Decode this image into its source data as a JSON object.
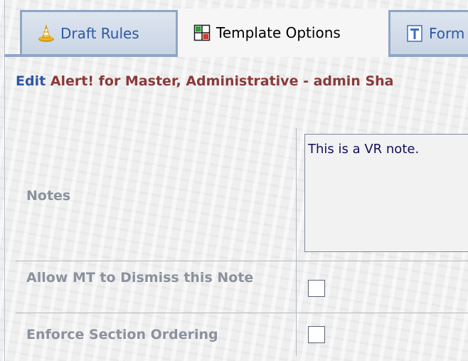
{
  "tabs": [
    {
      "label": "Draft Rules",
      "icon": "traffic-cone-icon",
      "active": false
    },
    {
      "label": "Template Options",
      "icon": "template-grid-icon",
      "active": true
    },
    {
      "label": "Form",
      "icon": "text-format-icon",
      "active": false
    }
  ],
  "header": {
    "verb": "Edit ",
    "title": "Alert! for Master, Administrative - admin Sha"
  },
  "form": {
    "notes_label": "Notes",
    "notes_value": "This is a VR note.",
    "dismiss_label": "Allow MT to Dismiss this Note",
    "dismiss_checked": false,
    "ordering_label": "Enforce Section Ordering",
    "ordering_checked": false
  },
  "colors": {
    "tab_text": "#2f58a4",
    "title_verb": "#2f58a4",
    "title_rest": "#8a3a3a",
    "label": "#8a929e",
    "tab_border": "#8fa6c6"
  }
}
